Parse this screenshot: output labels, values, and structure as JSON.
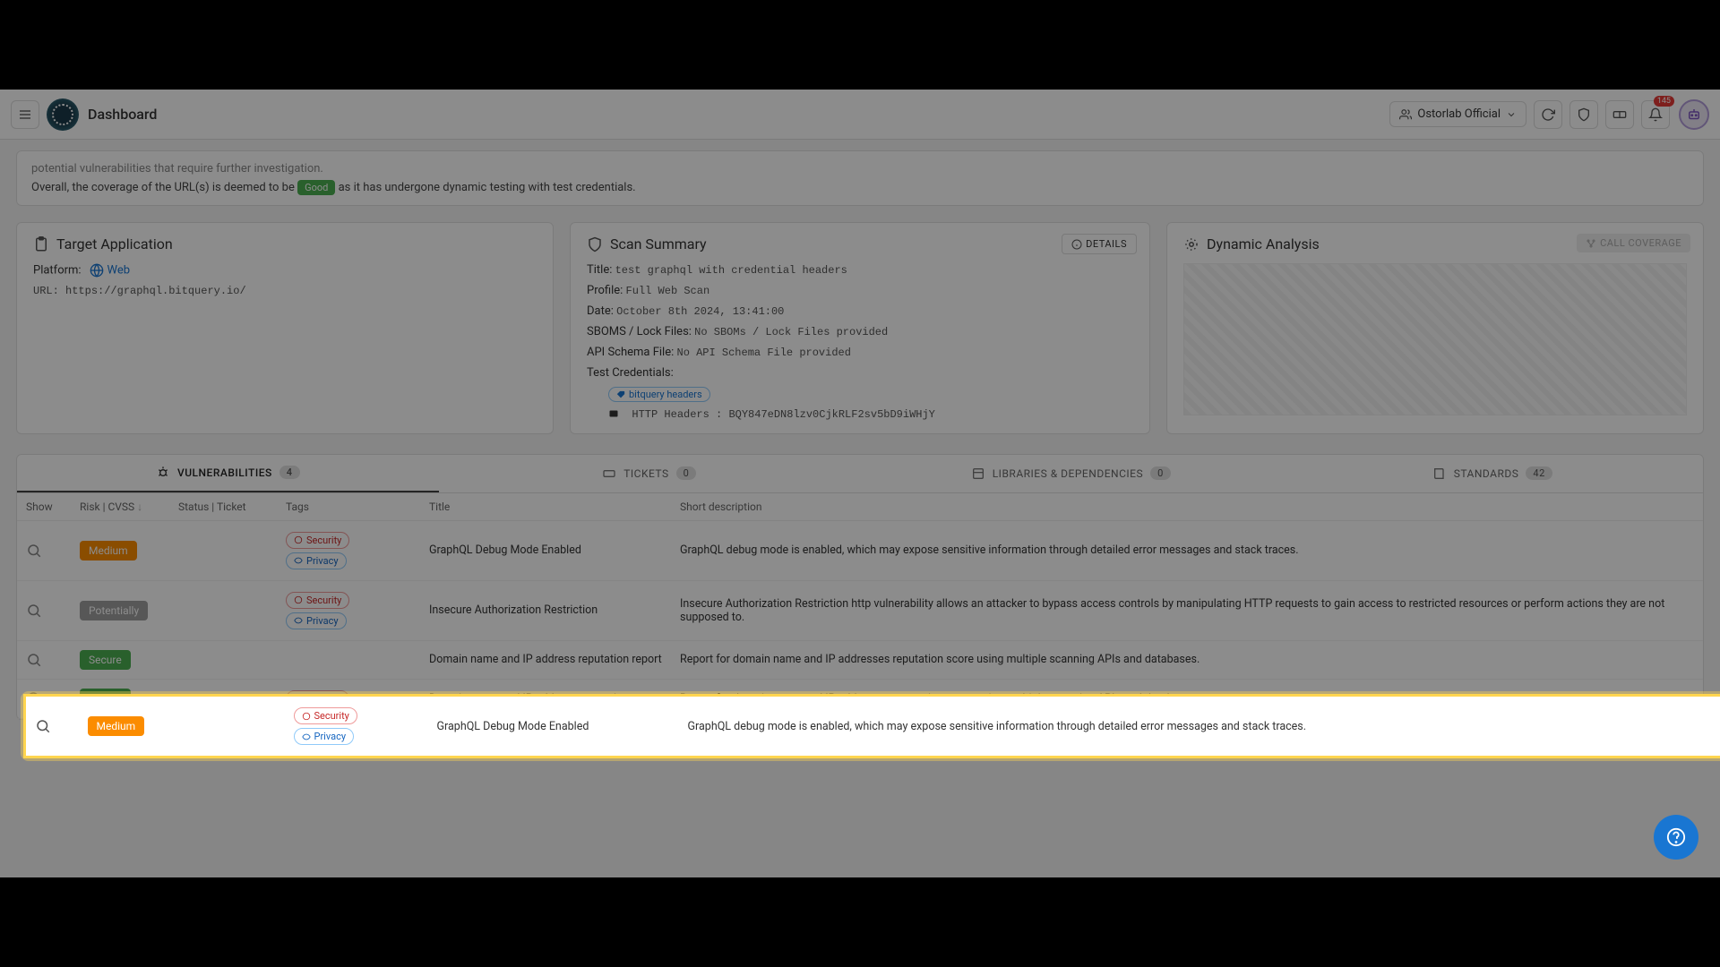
{
  "header": {
    "brand": "Dashboard",
    "org": "Ostorlab Official",
    "notif_count": "145"
  },
  "coverage": {
    "line1": "potential vulnerabilities that require further investigation.",
    "line2a": "Overall, the coverage of the URL(s) is deemed to be ",
    "good": "Good",
    "line2b": " as it has undergone dynamic testing with test credentials."
  },
  "target": {
    "title": "Target Application",
    "platform_label": "Platform:",
    "platform_value": "Web",
    "url_label": "URL:",
    "url_value": "https://graphql.bitquery.io/"
  },
  "scan": {
    "title": "Scan Summary",
    "details_btn": "DETAILS",
    "title_label": "Title:",
    "title_value": "test graphql with credential headers",
    "profile_label": "Profile:",
    "profile_value": "Full Web Scan",
    "date_label": "Date:",
    "date_value": "October 8th 2024, 13:41:00",
    "sbom_label": "SBOMS / Lock Files:",
    "sbom_value": "No SBOMs / Lock Files provided",
    "api_label": "API Schema File:",
    "api_value": "No API Schema File provided",
    "cred_label": "Test Credentials:",
    "cred_pill": "bitquery headers",
    "http_label": "HTTP Headers :",
    "http_value": "BQY847eDN8lzv0CjkRLF2sv5bD9iWHjY"
  },
  "dyn": {
    "title": "Dynamic Analysis",
    "btn": "CALL COVERAGE"
  },
  "tabs": {
    "vuln": "VULNERABILITIES",
    "vuln_count": "4",
    "tickets": "TICKETS",
    "tickets_count": "0",
    "libs": "LIBRARIES & DEPENDENCIES",
    "libs_count": "0",
    "std": "STANDARDS",
    "std_count": "42"
  },
  "cols": {
    "show": "Show",
    "risk": "Risk | CVSS",
    "status": "Status | Ticket",
    "tags": "Tags",
    "title": "Title",
    "desc": "Short description"
  },
  "tags": {
    "security": "Security",
    "privacy": "Privacy"
  },
  "rows": [
    {
      "risk": "Medium",
      "risk_class": "risk-medium",
      "tags": [
        "security",
        "privacy"
      ],
      "title": "GraphQL Debug Mode Enabled",
      "desc": "GraphQL debug mode is enabled, which may expose sensitive information through detailed error messages and stack traces."
    },
    {
      "risk": "Potentially",
      "risk_class": "risk-pot",
      "tags": [
        "security",
        "privacy"
      ],
      "title": "Insecure Authorization Restriction",
      "desc": "Insecure Authorization Restriction http vulnerability allows an attacker to bypass access controls by manipulating HTTP requests to gain access to restricted resources or perform actions they are not supposed to."
    },
    {
      "risk": "Secure",
      "risk_class": "risk-secure",
      "tags": [],
      "title": "Domain name and IP address reputation report",
      "desc": "Report for domain name and IP addresses reputation score using multiple scanning APIs and databases."
    },
    {
      "risk": "Secure",
      "risk_class": "risk-secure",
      "tags": [
        "security"
      ],
      "title": "Domain name and IP address reputation report",
      "desc": "Report for domain name and IP addresses reputation score using multiple scanning APIs and databases."
    }
  ]
}
